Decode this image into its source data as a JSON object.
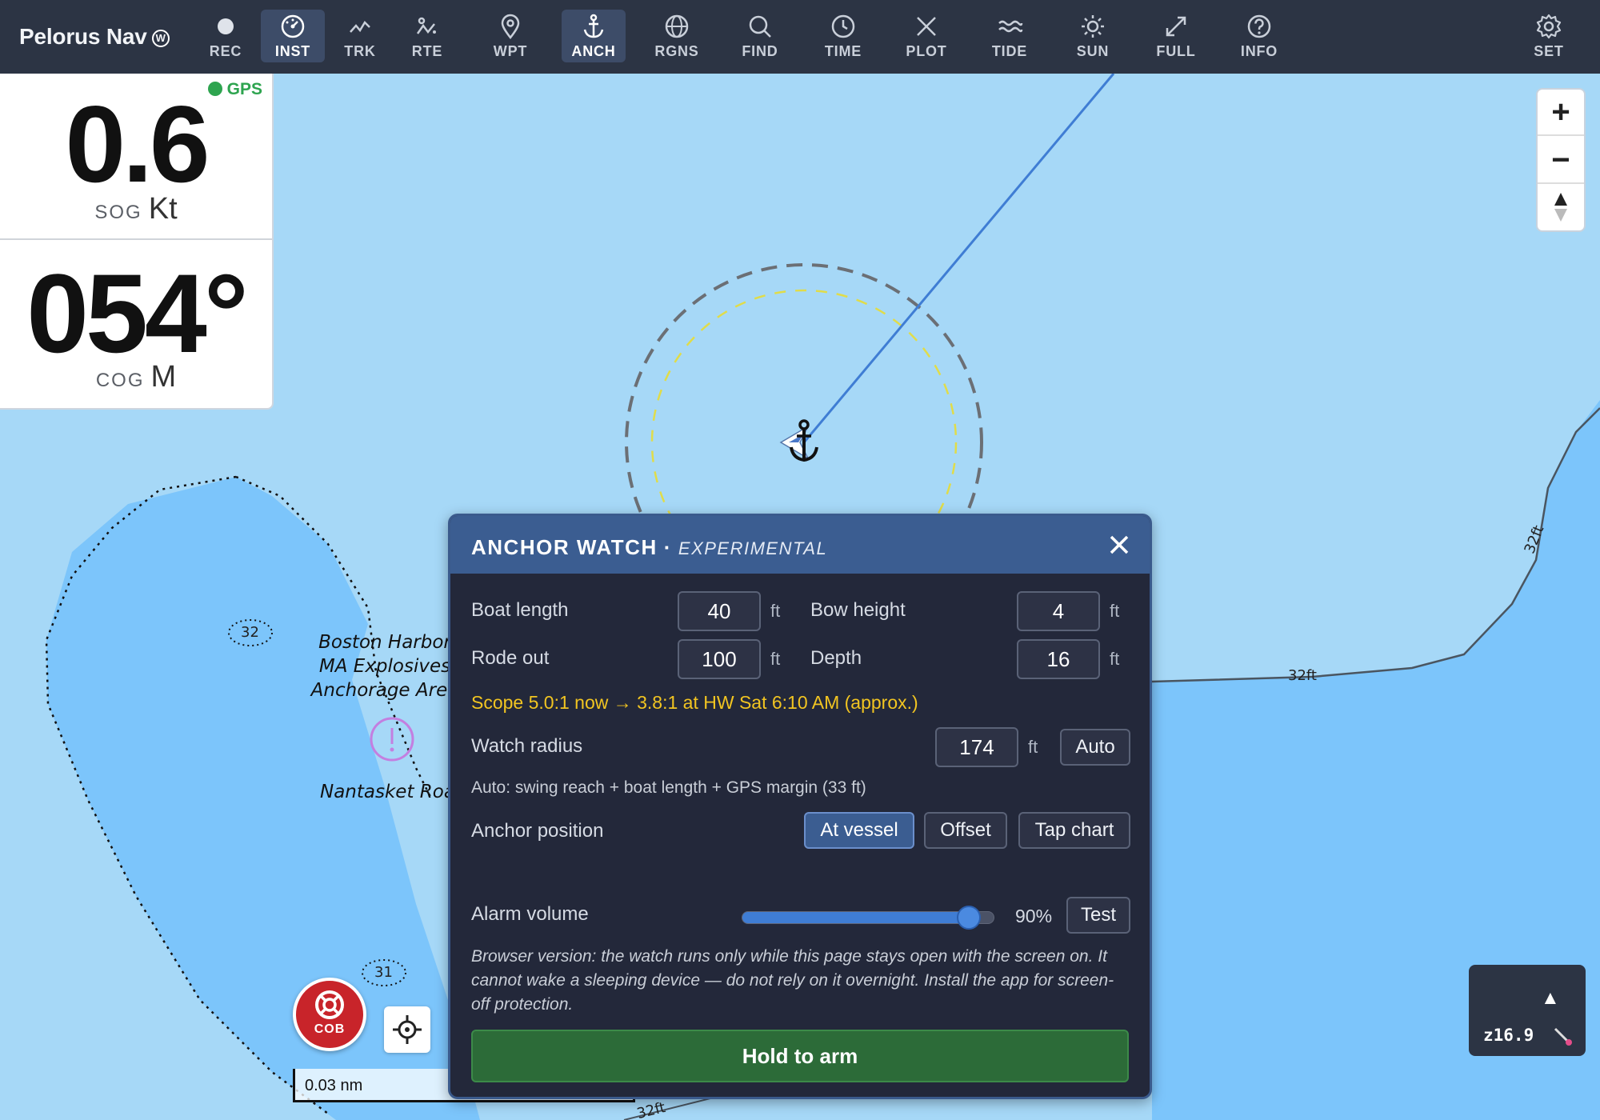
{
  "app": {
    "title": "Pelorus Nav",
    "badge": "W"
  },
  "toolbar": {
    "items": [
      {
        "label": "REC",
        "icon": "record-dot-icon"
      },
      {
        "label": "INST",
        "icon": "gauge-icon",
        "active": true
      },
      {
        "label": "TRK",
        "icon": "track-icon"
      },
      {
        "label": "RTE",
        "icon": "route-icon"
      },
      {
        "label": "WPT",
        "icon": "map-pin-icon"
      },
      {
        "label": "ANCH",
        "icon": "anchor-icon",
        "active": true
      },
      {
        "label": "RGNS",
        "icon": "globe-icon"
      },
      {
        "label": "FIND",
        "icon": "search-icon"
      },
      {
        "label": "TIME",
        "icon": "clock-icon"
      },
      {
        "label": "PLOT",
        "icon": "cross-icon"
      },
      {
        "label": "TIDE",
        "icon": "waves-icon"
      },
      {
        "label": "SUN",
        "icon": "sun-icon"
      },
      {
        "label": "FULL",
        "icon": "fullscreen-icon"
      },
      {
        "label": "INFO",
        "icon": "help-icon"
      },
      {
        "label": "SET",
        "icon": "gear-icon"
      }
    ]
  },
  "instruments": {
    "gps_label": "GPS",
    "sog": {
      "value": "0.6",
      "name": "SOG",
      "unit": "Kt"
    },
    "cog": {
      "value": "054°",
      "name": "COG",
      "unit": "M"
    }
  },
  "map": {
    "labels": {
      "harbor_area": "Boston Harbor\nMA Explosives\nAnchorage Area",
      "nantasket": "Nantasket Road"
    },
    "depth_tags": [
      "32",
      "31"
    ],
    "contour_labels": [
      "32ft",
      "32ft",
      "32ft"
    ],
    "scale": "0.03 nm",
    "zoom_level": "z16.9",
    "zoom_arrow": "▲"
  },
  "cob": {
    "label": "COB"
  },
  "anchor_watch": {
    "title": "ANCHOR WATCH",
    "separator": "·",
    "subtitle": "EXPERIMENTAL",
    "fields": {
      "boat_length": {
        "label": "Boat length",
        "value": "40",
        "unit": "ft"
      },
      "bow_height": {
        "label": "Bow height",
        "value": "4",
        "unit": "ft"
      },
      "rode_out": {
        "label": "Rode out",
        "value": "100",
        "unit": "ft"
      },
      "depth": {
        "label": "Depth",
        "value": "16",
        "unit": "ft"
      }
    },
    "scope_text": "Scope 5.0:1 now → 3.8:1 at HW Sat 6:10 AM (approx.)",
    "watch_radius": {
      "label": "Watch radius",
      "value": "174",
      "unit": "ft",
      "auto_button": "Auto"
    },
    "auto_note": "Auto: swing reach + boat length + GPS margin (33 ft)",
    "anchor_position": {
      "label": "Anchor position",
      "options": [
        "At vessel",
        "Offset",
        "Tap chart"
      ],
      "selected": "At vessel"
    },
    "alarm_volume": {
      "label": "Alarm volume",
      "percent": 90,
      "percent_text": "90%",
      "test_button": "Test"
    },
    "disclaimer": "Browser version: the watch runs only while this page stays open with the screen on. It cannot wake a sleeping device — do not rely on it overnight. Install the app for screen-off protection.",
    "arm_button": "Hold to arm"
  },
  "colors": {
    "toolbar": "#2c3444",
    "active_tool": "#3d4c68",
    "water_shallow": "#a6d8f7",
    "water_deep": "#7cc5fb",
    "dialog_bg": "#23283a",
    "dialog_header": "#3b5d91",
    "scope_text": "#f2c521",
    "arm_button": "#2c6b38",
    "cob": "#c8242a",
    "gps_ok": "#2ea44f"
  }
}
